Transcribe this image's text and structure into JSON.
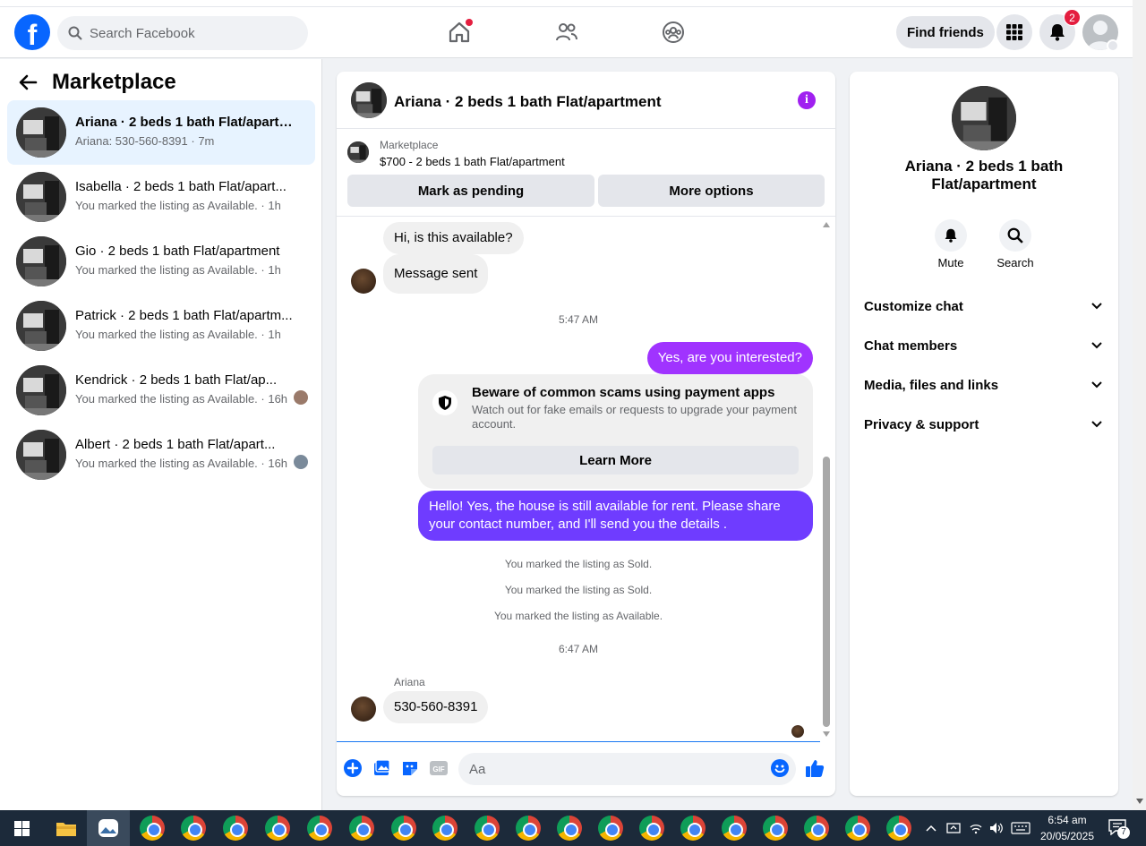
{
  "header": {
    "logo": "f",
    "search_placeholder": "Search Facebook",
    "find_friends": "Find friends",
    "notifications_count": "2"
  },
  "sidebar": {
    "title": "Marketplace",
    "conversations": [
      {
        "title": "Ariana · 2 beds 1 bath Flat/apartm...",
        "subtitle": "Ariana: 530-560-8391 · 7m",
        "active": true
      },
      {
        "title": "Isabella · 2 beds 1 bath Flat/apart...",
        "subtitle": "You marked the listing as Available. · 1h"
      },
      {
        "title": "Gio · 2 beds 1 bath Flat/apartment",
        "subtitle": "You marked the listing as Available. · 1h"
      },
      {
        "title": "Patrick · 2 beds 1 bath Flat/apartm...",
        "subtitle": "You marked the listing as Available. · 1h"
      },
      {
        "title": "Kendrick · 2 beds 1 bath Flat/ap...",
        "subtitle": "You marked the listing as Available. · 16h"
      },
      {
        "title": "Albert · 2 beds 1 bath Flat/apart...",
        "subtitle": "You marked the listing as Available. · 16h"
      }
    ]
  },
  "chat": {
    "title": "Ariana · 2 beds 1 bath Flat/apartment",
    "listing_label": "Marketplace",
    "listing_price": "$700 - 2 beds 1 bath Flat/apartment",
    "mark_pending": "Mark as pending",
    "more_options": "More options",
    "messages": {
      "m1": "Hi, is this available?",
      "m2": "Message sent",
      "time1": "5:47 AM",
      "m3": "Yes, are you interested?",
      "scam_title": "Beware of common scams using payment apps",
      "scam_text": "Watch out for fake emails or requests to upgrade your payment account.",
      "learn_more": "Learn More",
      "m4": "Hello! Yes, the house is still available for rent. Please share your contact number, and I'll send you the details .",
      "sys1": "You marked the listing as Sold.",
      "sys2": "You marked the listing as Sold.",
      "sys3": "You marked the listing as Available.",
      "time2": "6:47 AM",
      "sender": "Ariana",
      "m5": "530-560-8391"
    },
    "input_placeholder": "Aa"
  },
  "details": {
    "name": "Ariana · 2 beds 1 bath Flat/apartment",
    "mute": "Mute",
    "search": "Search",
    "sections": [
      "Customize chat",
      "Chat members",
      "Media, files and links",
      "Privacy & support"
    ]
  },
  "taskbar": {
    "time": "6:54 am",
    "date": "20/05/2025",
    "notif": "7"
  },
  "colors": {
    "brand": "#0866ff",
    "outgoing": "#a033ff",
    "outgoing2": "#6f3cff",
    "badge": "#e41e3f"
  }
}
